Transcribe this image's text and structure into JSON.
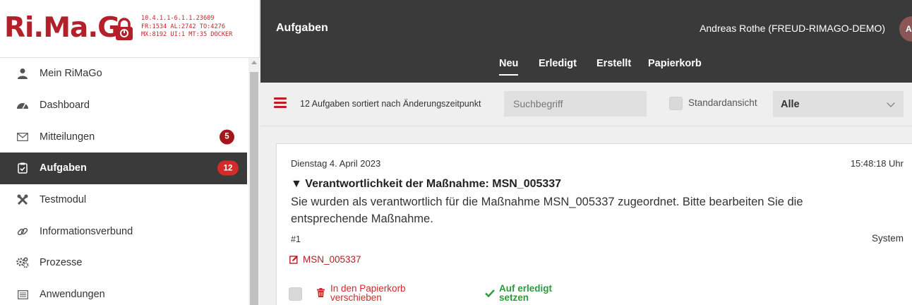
{
  "app": {
    "logo_text": "Ri.Ma.G",
    "version_info": "10.4.1.1-6.1.1.23609\nFR:1534 AL:2742 TO:4276\nMX:8192 UI:1 MT:35 DOCKER"
  },
  "sidebar": {
    "items": [
      {
        "label": "Mein RiMaGo",
        "icon": "user-icon",
        "badge": null
      },
      {
        "label": "Dashboard",
        "icon": "dashboard-gauge-icon",
        "badge": null
      },
      {
        "label": "Mitteilungen",
        "icon": "envelope-icon",
        "badge": "5"
      },
      {
        "label": "Aufgaben",
        "icon": "clipboard-check-icon",
        "badge": "12",
        "active": true
      },
      {
        "label": "Testmodul",
        "icon": "tools-icon",
        "badge": null
      },
      {
        "label": "Informationsverbund",
        "icon": "link-icon",
        "badge": null
      },
      {
        "label": "Prozesse",
        "icon": "cogs-icon",
        "badge": null
      },
      {
        "label": "Anwendungen",
        "icon": "list-icon",
        "badge": null
      }
    ]
  },
  "header": {
    "title": "Aufgaben",
    "user": "Andreas Rothe (FREUD-RIMAGO-DEMO)",
    "avatar_initials": "AR",
    "tabs": [
      {
        "label": "Neu",
        "active": true
      },
      {
        "label": "Erledigt"
      },
      {
        "label": "Erstellt"
      },
      {
        "label": "Papierkorb"
      }
    ]
  },
  "filter": {
    "count_text": "12 Aufgaben sortiert nach Änderungszeitpunkt",
    "search_placeholder": "Suchbegriff",
    "standard_view_label": "Standardansicht",
    "select_value": "Alle"
  },
  "task": {
    "date": "Dienstag 4. April 2023",
    "time": "15:48:18 Uhr",
    "title": "▼ Verantwortlichkeit der Maßnahme: MSN_005337",
    "body": "Sie wurden als verantwortlich für die Maßnahme MSN_005337 zugeordnet. Bitte bearbeiten Sie die entsprechende Maßnahme.",
    "number": "#1",
    "sender": "System",
    "link": "MSN_005337",
    "trash_line1": "In den Papierkorb",
    "trash_line2": "verschieben",
    "done_line1": "Auf erledigt",
    "done_line2": "setzen"
  },
  "colors": {
    "brand_red": "#b4202a",
    "header_dark": "#3a3a3a",
    "badge_red": "#a5161c",
    "success_green": "#2a9a3a"
  }
}
